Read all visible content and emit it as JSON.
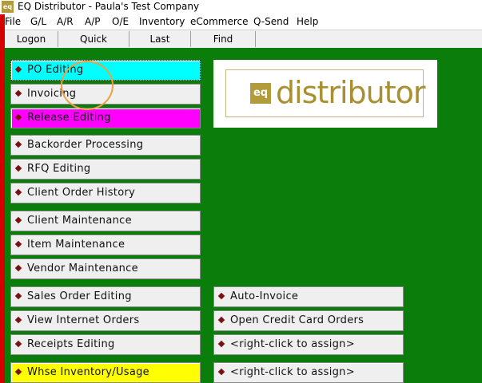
{
  "window": {
    "title": "EQ Distributor - Paula's Test Company",
    "icon_label": "eq"
  },
  "menu": [
    "File",
    "G/L",
    "A/R",
    "A/P",
    "O/E",
    "Inventory",
    "eCommerce",
    "Q-Send",
    "Help"
  ],
  "toolbar": {
    "logon": "Logon",
    "quick": "Quick",
    "last": "Last",
    "find": "Find"
  },
  "left_buttons": [
    "PO Editing",
    "Invoicing",
    "Release Editing",
    "Backorder Processing",
    "RFQ Editing",
    "Client Order History",
    "Client Maintenance",
    "Item Maintenance",
    "Vendor Maintenance",
    "Sales Order Editing",
    "View Internet Orders",
    "Receipts Editing",
    "Whse Inventory/Usage"
  ],
  "right_buttons": [
    "Auto-Invoice",
    "Open Credit Card Orders",
    "<right-click to assign>",
    "<right-click to assign>"
  ],
  "logo": {
    "mark": "eq",
    "text": "distributor"
  },
  "colors": {
    "background": "#0a7d0a",
    "highlight_cyan": "#00ffff",
    "highlight_magenta": "#ff00ff",
    "highlight_yellow": "#ffff00",
    "bullet": "#7a1010"
  }
}
